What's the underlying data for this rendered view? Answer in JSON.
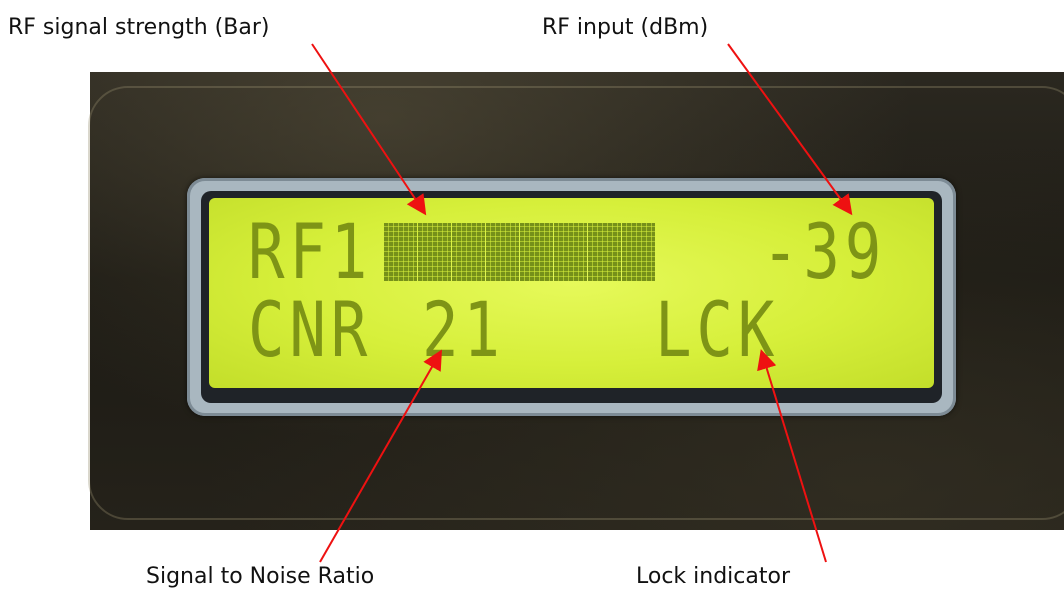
{
  "callouts": {
    "rf_bar": "RF signal strength (Bar)",
    "rf_input": "RF input (dBm)",
    "snr": "Signal to Noise Ratio",
    "lock": "Lock indicator"
  },
  "lcd": {
    "line1_label": "RF1",
    "line1_value": "-39",
    "line2_label": "CNR",
    "line2_value": "21",
    "line2_status": "LCK",
    "signal_bar_blocks": 8,
    "text_color": "#7e9416",
    "background_color": "#d6ef3a"
  },
  "arrow_color": "#ee1111"
}
